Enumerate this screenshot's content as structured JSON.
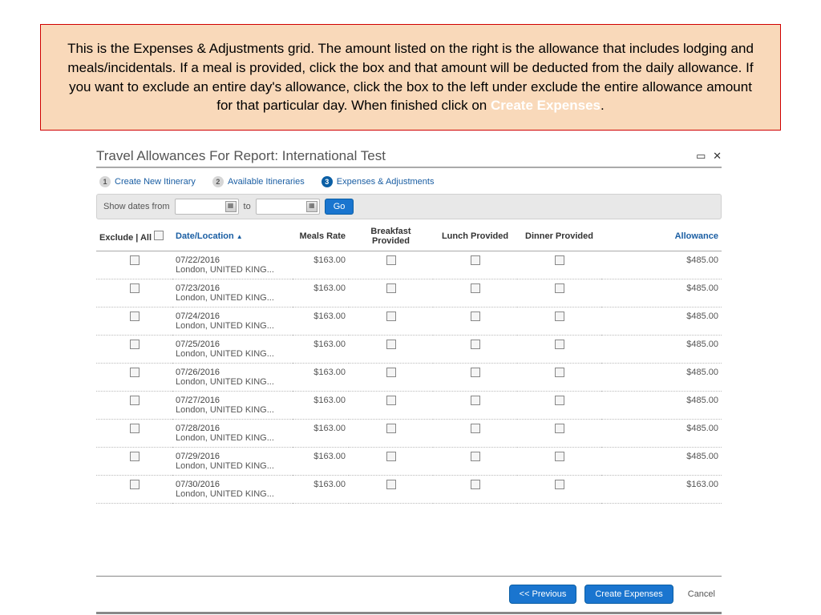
{
  "callout": {
    "text_before": "This is the Expenses & Adjustments grid.  The amount listed on the right is the allowance that includes lodging and meals/incidentals.  If a meal is provided, click the box and that amount will be deducted from the daily allowance.  If you want to exclude an entire day's allowance, click the box to the left under exclude the entire allowance amount for that particular day.  When finished click on  ",
    "highlight": "Create Expenses",
    "text_after": "."
  },
  "panel": {
    "title": "Travel Allowances For Report: International Test"
  },
  "steps": {
    "s1": {
      "num": "1",
      "label": "Create New Itinerary"
    },
    "s2": {
      "num": "2",
      "label": "Available Itineraries"
    },
    "s3": {
      "num": "3",
      "label": "Expenses & Adjustments"
    }
  },
  "filter": {
    "label": "Show dates from",
    "to": "to",
    "go": "Go"
  },
  "headers": {
    "exclude": "Exclude | All",
    "dateloc": "Date/Location",
    "meals": "Meals Rate",
    "breakfast": "Breakfast Provided",
    "lunch": "Lunch Provided",
    "dinner": "Dinner Provided",
    "allowance": "Allowance"
  },
  "rows": [
    {
      "date": "07/22/2016",
      "loc": "London, UNITED KING...",
      "meals": "$163.00",
      "allow": "$485.00"
    },
    {
      "date": "07/23/2016",
      "loc": "London, UNITED KING...",
      "meals": "$163.00",
      "allow": "$485.00"
    },
    {
      "date": "07/24/2016",
      "loc": "London, UNITED KING...",
      "meals": "$163.00",
      "allow": "$485.00"
    },
    {
      "date": "07/25/2016",
      "loc": "London, UNITED KING...",
      "meals": "$163.00",
      "allow": "$485.00"
    },
    {
      "date": "07/26/2016",
      "loc": "London, UNITED KING...",
      "meals": "$163.00",
      "allow": "$485.00"
    },
    {
      "date": "07/27/2016",
      "loc": "London, UNITED KING...",
      "meals": "$163.00",
      "allow": "$485.00"
    },
    {
      "date": "07/28/2016",
      "loc": "London, UNITED KING...",
      "meals": "$163.00",
      "allow": "$485.00"
    },
    {
      "date": "07/29/2016",
      "loc": "London, UNITED KING...",
      "meals": "$163.00",
      "allow": "$485.00"
    },
    {
      "date": "07/30/2016",
      "loc": "London, UNITED KING...",
      "meals": "$163.00",
      "allow": "$163.00"
    }
  ],
  "footer": {
    "prev": "<< Previous",
    "create": "Create Expenses",
    "cancel": "Cancel"
  }
}
